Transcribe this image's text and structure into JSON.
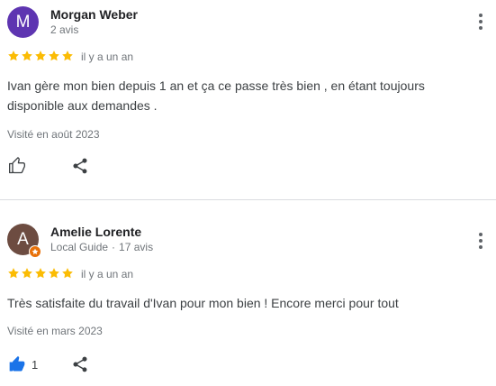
{
  "colors": {
    "star": "#fbbc04",
    "like_active": "#1a73e8",
    "avatar_1": "#5e35b1",
    "avatar_2": "#6d4c41",
    "local_guide_badge": "#e8710a"
  },
  "reviews": [
    {
      "avatar_letter": "M",
      "name": "Morgan Weber",
      "subtitle": "2 avis",
      "rating": 5,
      "time": "il y a un an",
      "text": "Ivan gère mon bien depuis 1 an et ça ce passe très bien , en étant toujours disponible aux demandes .",
      "visited": "Visité en août 2023",
      "like_icon": "thumbs-up-outline-icon",
      "likes": ""
    },
    {
      "avatar_letter": "A",
      "name": "Amelie Lorente",
      "badge": "Local Guide",
      "separator": "·",
      "review_count": "17 avis",
      "rating": 5,
      "time": "il y a un an",
      "text": "Très satisfaite du travail d'Ivan pour mon bien ! Encore merci pour tout",
      "visited": "Visité en mars 2023",
      "like_icon": "thumbs-up-filled-icon",
      "likes": "1"
    }
  ]
}
